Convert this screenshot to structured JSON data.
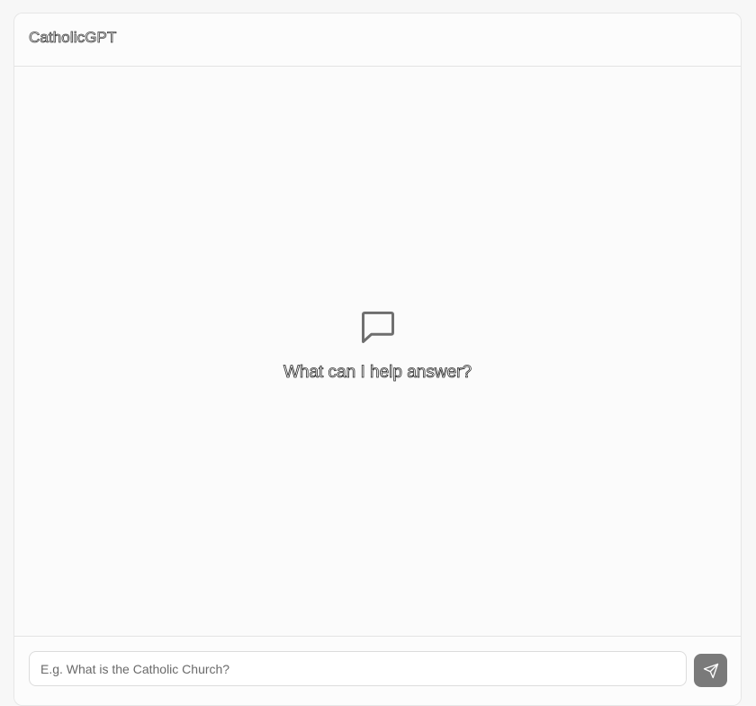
{
  "header": {
    "app_title": "CatholicGPT"
  },
  "empty_state": {
    "icon": "message-square-icon",
    "text": "What can I help answer?"
  },
  "composer": {
    "input_value": "",
    "placeholder": "E.g. What is the Catholic Church?",
    "send_icon": "send-icon"
  },
  "colors": {
    "send_button_bg": "#7a7a7a",
    "icon_stroke": "#6e6e6e"
  }
}
